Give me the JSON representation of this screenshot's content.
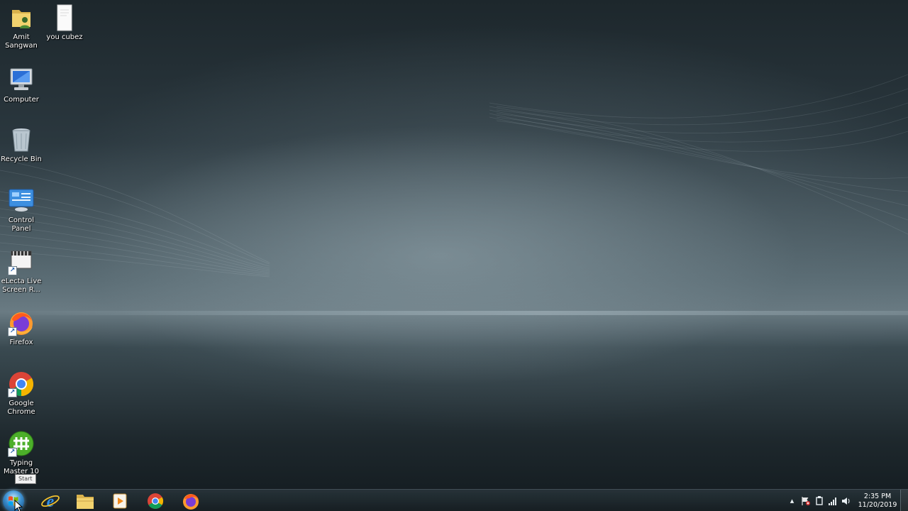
{
  "desktop_icons": [
    {
      "label": "Amit Sangwan",
      "icon": "user-folder-icon"
    },
    {
      "label": "you cubez",
      "icon": "document-icon"
    },
    {
      "label": "Computer",
      "icon": "computer-icon"
    },
    {
      "label": "Recycle Bin",
      "icon": "recycle-bin-icon"
    },
    {
      "label": "Control Panel",
      "icon": "control-panel-icon"
    },
    {
      "label": "eLecta Live Screen R...",
      "icon": "screen-recorder-icon"
    },
    {
      "label": "Firefox",
      "icon": "firefox-icon"
    },
    {
      "label": "Google Chrome",
      "icon": "chrome-icon"
    },
    {
      "label": "Typing Master 10",
      "icon": "typing-master-icon"
    }
  ],
  "taskbar": {
    "start_tooltip": "Start",
    "pinned": [
      {
        "icon": "internet-explorer-icon"
      },
      {
        "icon": "file-explorer-icon"
      },
      {
        "icon": "media-player-icon"
      },
      {
        "icon": "chrome-icon"
      },
      {
        "icon": "firefox-icon"
      }
    ]
  },
  "tray": {
    "time": "2:35 PM",
    "date": "11/20/2019",
    "icons": [
      "show-hidden-icons-arrow",
      "action-center-flag-icon",
      "device-icon",
      "network-signal-icon",
      "volume-icon"
    ]
  },
  "colors": {
    "chrome_red": "#db4437",
    "chrome_green": "#0f9d58",
    "chrome_yellow": "#f4b400",
    "chrome_blue": "#4285f4",
    "firefox_orange": "#ff7a1a",
    "firefox_purple": "#6b2fc0"
  }
}
